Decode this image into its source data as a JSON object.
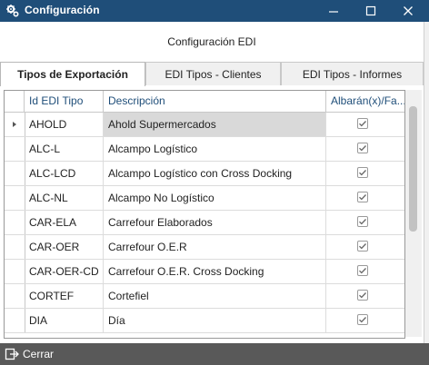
{
  "window": {
    "title": "Configuración",
    "minimize_label": "minimize",
    "maximize_label": "maximize",
    "close_label": "close"
  },
  "header": {
    "title": "Configuración EDI"
  },
  "tabs": [
    {
      "label": "Tipos de Exportación",
      "active": true
    },
    {
      "label": "EDI Tipos - Clientes",
      "active": false
    },
    {
      "label": "EDI Tipos - Informes",
      "active": false
    }
  ],
  "grid": {
    "columns": [
      "Id EDI Tipo",
      "Descripción",
      "Albarán(x)/Fa..."
    ],
    "selected_row": 0,
    "rows": [
      {
        "id": "AHOLD",
        "desc": "Ahold Supermercados",
        "checked": true
      },
      {
        "id": "ALC-L",
        "desc": "Alcampo Logístico",
        "checked": true
      },
      {
        "id": "ALC-LCD",
        "desc": "Alcampo Logístico con Cross Docking",
        "checked": true
      },
      {
        "id": "ALC-NL",
        "desc": "Alcampo No Logístico",
        "checked": true
      },
      {
        "id": "CAR-ELA",
        "desc": "Carrefour Elaborados",
        "checked": true
      },
      {
        "id": "CAR-OER",
        "desc": "Carrefour O.E.R",
        "checked": true
      },
      {
        "id": "CAR-OER-CD",
        "desc": "Carrefour O.E.R. Cross Docking",
        "checked": true
      },
      {
        "id": "CORTEF",
        "desc": "Cortefiel",
        "checked": true
      },
      {
        "id": "DIA",
        "desc": "Día",
        "checked": true
      }
    ]
  },
  "footer": {
    "close_label": "Cerrar"
  },
  "colors": {
    "titlebar": "#1f4e79",
    "footer": "#595959",
    "selection": "#d9d9d9",
    "header_text": "#1f4e79"
  }
}
